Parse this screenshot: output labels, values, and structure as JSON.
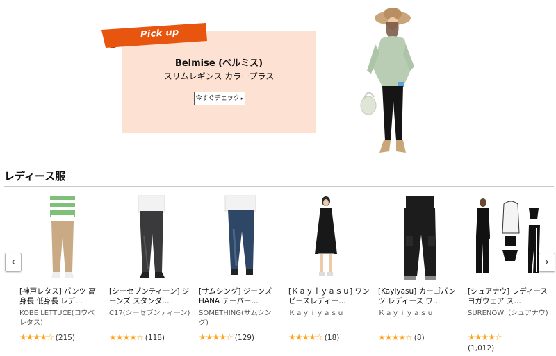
{
  "banner": {
    "pickup_label": "Pick up",
    "brand": "Belmise (ベルミス)",
    "subtitle": "スリムレギンス カラープラス",
    "cta": "今すぐチェック",
    "colors": {
      "panel": "#fde1d3",
      "ribbon": "#e8550f",
      "ribbon_shadow": "#b23c05"
    }
  },
  "section": {
    "title": "レディース服"
  },
  "carousel": {
    "prev_icon": "chevron-left-icon",
    "next_icon": "chevron-right-icon"
  },
  "products": [
    {
      "title": "[神戸レタス] パンツ 高身長 低身長 レデ…",
      "brand": "KOBE LETTUCE(コウベレタス)",
      "stars": "★★★★☆",
      "rating": 4.0,
      "reviews": "(215)"
    },
    {
      "title": "[シーセブンティーン] ジーンズ スタンダ…",
      "brand": "C17(シーセブンティーン)",
      "stars": "★★★★☆",
      "rating": 4.0,
      "reviews": "(118)"
    },
    {
      "title": "[サムシング] ジーンズ HANA テーパー…",
      "brand": "SOMETHING(サムシング)",
      "stars": "★★★★☆",
      "rating": 4.0,
      "reviews": "(129)"
    },
    {
      "title": "[Ｋａｙｉｙａｓｕ] ワンピースレディー…",
      "brand": "Ｋａｙｉｙａｓｕ",
      "stars": "★★★★☆",
      "rating": 4.0,
      "reviews": "(18)"
    },
    {
      "title": "[Kayiyasu] カーゴパンツ レディース ワ…",
      "brand": "Ｋａｙｉｙａｓｕ",
      "stars": "★★★★☆",
      "rating": 4.5,
      "reviews": "(8)"
    },
    {
      "title": "[シュアナウ] レディース ヨガウェア ス…",
      "brand": "SURENOW（シュアナウ)",
      "stars": "★★★★☆",
      "rating": 4.0,
      "reviews": "(1,012)"
    }
  ],
  "colors": {
    "star": "#ffa41c",
    "text": "#0f1111",
    "rule": "#c8c8c8"
  }
}
